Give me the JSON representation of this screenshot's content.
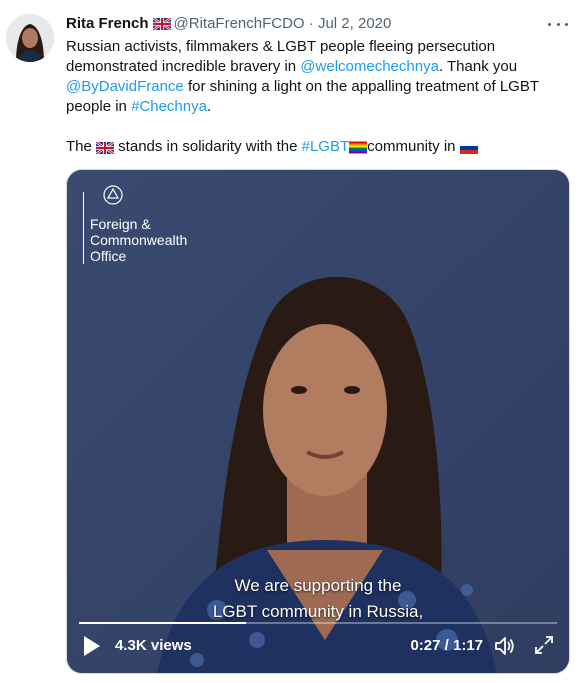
{
  "author": {
    "name": "Rita French",
    "handle": "@RitaFrenchFCDO",
    "separator": "·",
    "date": "Jul 2, 2020"
  },
  "tweet": {
    "line1_pre": "Russian activists, filmmakers & LGBT people fleeing persecution demonstrated incredible bravery in ",
    "mention1": "@welcomechechnya",
    "line1_post": ". Thank you ",
    "mention2": "@ByDavidFrance",
    "line2_post": " for shining a light on the appalling treatment of LGBT people in ",
    "hashtag1": "#Chechnya",
    "line2_end": ".",
    "line3_pre": "The ",
    "line3_mid": " stands in solidarity with the ",
    "hashtag2": "#LGBT",
    "line3_post": "community in "
  },
  "video": {
    "logo_line1": "Foreign &",
    "logo_line2": "Commonwealth",
    "logo_line3": "Office",
    "subtitle_line1": "We are supporting the",
    "subtitle_line2": "LGBT community in Russia,",
    "views": "4.3K views",
    "time": "0:27 / 1:17",
    "progress": 0.35
  },
  "icons": {
    "more": "more-icon",
    "play": "play-icon",
    "volume": "volume-icon",
    "fullscreen": "fullscreen-icon"
  },
  "colors": {
    "link": "#1d9bf0",
    "muted": "#536471",
    "video_bg": "#3e4f76"
  }
}
